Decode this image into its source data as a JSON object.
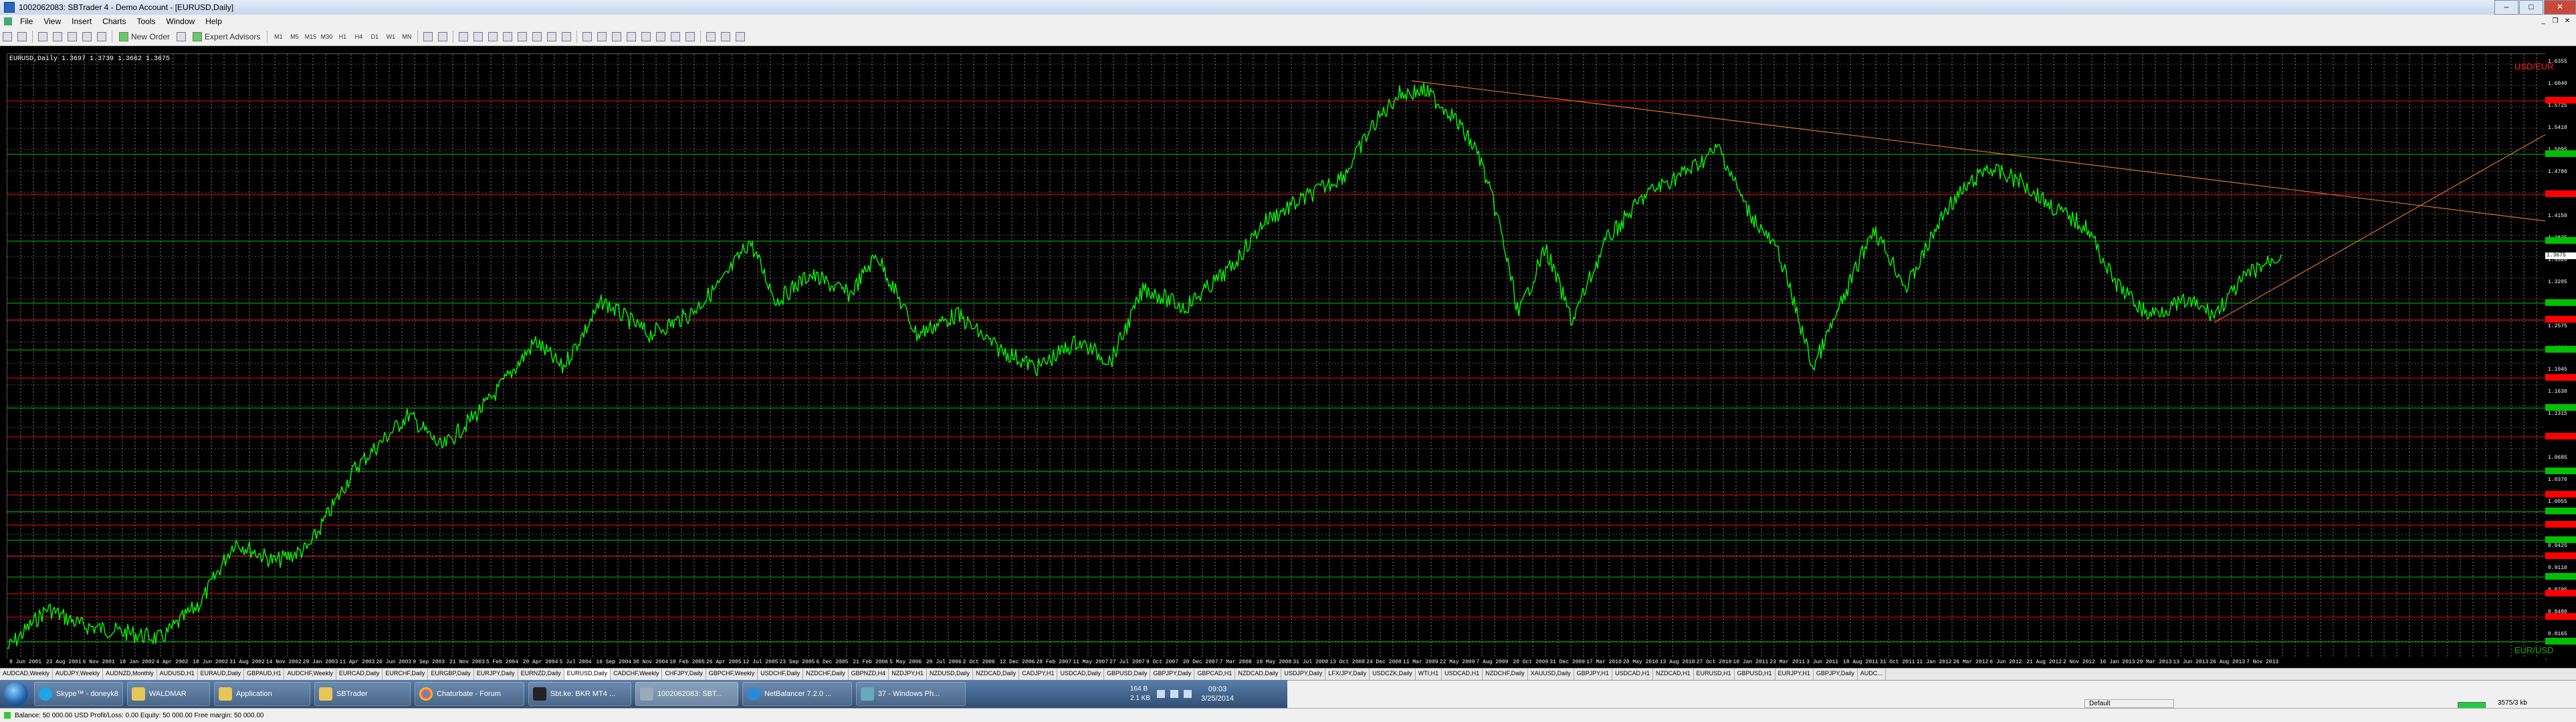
{
  "window": {
    "title": "1002062083: SBTrader 4 - Demo Account - [EURUSD,Daily]"
  },
  "menu": [
    "File",
    "View",
    "Insert",
    "Charts",
    "Tools",
    "Window",
    "Help"
  ],
  "toolbar": {
    "new_order_label": "New Order",
    "expert_advisors_label": "Expert Advisors",
    "timeframes": [
      "M1",
      "M5",
      "M15",
      "M30",
      "H1",
      "H4",
      "D1",
      "W1",
      "MN"
    ]
  },
  "chart": {
    "info": "EURUSD,Daily  1.3697 1.3739 1.3662 1.3675",
    "corner_top_right": "USD/EUR",
    "corner_bottom_right": "EUR/USD",
    "price_ticks": [
      "1.6355",
      "1.6040",
      "1.5725",
      "1.5410",
      "1.5095",
      "1.4780",
      "1.4465",
      "1.4150",
      "1.3835",
      "1.3520",
      "1.3205",
      "1.2890",
      "1.2575",
      "1.2260",
      "1.1945",
      "1.1630",
      "1.1315",
      "1.1000",
      "1.0685",
      "1.0370",
      "1.0055",
      "0.9740",
      "0.9425",
      "0.9110",
      "0.8795",
      "0.8480",
      "0.8165"
    ],
    "current_price_tag": "1.3675",
    "date_ticks": [
      "8 Jun 2001",
      "23 Aug 2001",
      "6 Nov 2001",
      "18 Jan 2002",
      "4 Apr 2002",
      "18 Jun 2002",
      "31 Aug 2002",
      "14 Nov 2002",
      "29 Jan 2003",
      "11 Apr 2003",
      "26 Jun 2003",
      "9 Sep 2003",
      "21 Nov 2003",
      "5 Feb 2004",
      "20 Apr 2004",
      "5 Jul 2004",
      "16 Sep 2004",
      "30 Nov 2004",
      "10 Feb 2005",
      "26 Apr 2005",
      "12 Jul 2005",
      "23 Sep 2005",
      "6 Dec 2005",
      "21 Feb 2006",
      "5 May 2006",
      "20 Jul 2006",
      "2 Oct 2006",
      "12 Dec 2006",
      "28 Feb 2007",
      "11 May 2007",
      "27 Jul 2007",
      "9 Oct 2007",
      "20 Dec 2007",
      "7 Mar 2008",
      "19 May 2008",
      "31 Jul 2008",
      "13 Oct 2008",
      "24 Dec 2008",
      "11 Mar 2009",
      "22 May 2009",
      "7 Aug 2009",
      "20 Oct 2009",
      "31 Dec 2009",
      "17 Mar 2010",
      "28 May 2010",
      "13 Aug 2010",
      "27 Oct 2010",
      "10 Jan 2011",
      "23 Mar 2011",
      "3 Jun 2011",
      "18 Aug 2011",
      "31 Oct 2011",
      "11 Jan 2012",
      "26 Mar 2012",
      "6 Jun 2012",
      "21 Aug 2012",
      "2 Nov 2012",
      "16 Jan 2013",
      "29 Mar 2013",
      "13 Jun 2013",
      "26 Aug 2013",
      "7 Nov 2013"
    ]
  },
  "tabs": [
    "AUDCAD,Weekly",
    "AUDJPY,Weekly",
    "AUDNZD,Monthly",
    "AUDUSD,H1",
    "EURAUD,Daily",
    "GBPAUD,H1",
    "AUDCHF,Weekly",
    "EURCAD,Daily",
    "EURCHF,Daily",
    "EURGBP,Daily",
    "EURJPY,Daily",
    "EURNZD,Daily",
    "EURUSD,Daily",
    "CADCHF,Weekly",
    "CHFJPY,Daily",
    "GBPCHF,Weekly",
    "USDCHF,Daily",
    "NZDCHF,Daily",
    "GBPNZD,H4",
    "NZDJPY,H1",
    "NZDUSD,Daily",
    "NZDCAD,Daily",
    "CADJPY,H1",
    "USDCAD,Daily",
    "GBPUSD,Daily",
    "GBPJPY,Daily",
    "GBPCAD,H1",
    "NZDCAD,Daily",
    "USDJPY,Daily",
    "LFX/JPY,Daily",
    "USDCZK,Daily",
    "WTI,H1",
    "USDCAD,H1",
    "NZDCHF,Daily",
    "XAUUSD,Daily",
    "GBPJPY,H1",
    "USDCAD,H1",
    "NZDCAD,H1",
    "EURUSD,H1",
    "GBPUSD,H1",
    "EURJPY,H1",
    "GBPJPY,Daily",
    "AUDC..."
  ],
  "taskbar": {
    "buttons": [
      "Skype™ - doneyk8",
      "WALDMAR",
      "Application",
      "SBTrader",
      "Chaturbate - Forum",
      "Sbt.ke: BKR MT4 ...",
      "1002062083: SBT...",
      "NetBalancer 7.2.0 ...",
      "37 - Windows Ph..."
    ],
    "net_up": "164 B",
    "net_down": "2.1 KB",
    "time": "09:03",
    "date": "3/25/2014"
  },
  "status": {
    "profile": "Default",
    "rate": "3575/3 kb"
  },
  "balance_text": "Balance: 50 000.00 USD  Profit/Loss: 0.00  Equity: 50 000.00  Free margin: 50 000.00",
  "colors": {
    "price_line": "#00ff00",
    "horizontal_red": "#ff0000",
    "horizontal_green": "#00c000",
    "trend_orange": "#d9722a",
    "corner_red": "#ff2020",
    "corner_green": "#1aa81a"
  }
}
